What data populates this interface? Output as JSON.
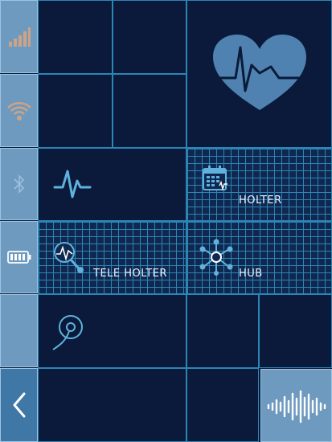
{
  "sidebar": {
    "items": [
      {
        "icon": "signal-strength-icon"
      },
      {
        "icon": "wifi-icon"
      },
      {
        "icon": "bluetooth-icon"
      },
      {
        "icon": "battery-icon"
      },
      {
        "icon": "empty"
      },
      {
        "icon": "back-arrow-icon"
      }
    ]
  },
  "tiles": {
    "holter": {
      "label": "HOLTER",
      "icon": "calendar-icon"
    },
    "tele_holter": {
      "label": "TELE HOLTER",
      "icon": "tele-holter-icon"
    },
    "hub": {
      "label": "HUB",
      "icon": "hub-network-icon"
    },
    "ecg": {
      "icon": "ecg-wave-icon"
    },
    "heart": {
      "icon": "heart-ecg-icon"
    },
    "sensor": {
      "icon": "sensor-probe-icon"
    },
    "audio": {
      "icon": "audio-waveform-icon"
    }
  },
  "colors": {
    "background": "#0b1a3a",
    "grid_line": "#2b86b6",
    "sidebar": "#6e9ac0",
    "icon_light": "#5fb2de",
    "heart": "#4f82b0"
  }
}
